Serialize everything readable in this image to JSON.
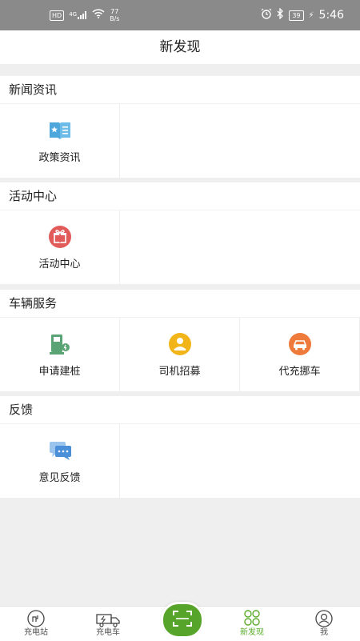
{
  "status_bar": {
    "hd": "HD",
    "net_gen": "4G",
    "speed_value": "77",
    "speed_unit": "B/s",
    "battery": "39",
    "time": "5:46"
  },
  "page": {
    "title": "新发现"
  },
  "sections": [
    {
      "title": "新闻资讯",
      "items": [
        {
          "label": "政策资讯",
          "icon": "policy-news-icon"
        }
      ]
    },
    {
      "title": "活动中心",
      "items": [
        {
          "label": "活动中心",
          "icon": "gift-icon"
        }
      ]
    },
    {
      "title": "车辆服务",
      "items": [
        {
          "label": "申请建桩",
          "icon": "charging-pile-icon"
        },
        {
          "label": "司机招募",
          "icon": "driver-recruit-icon"
        },
        {
          "label": "代充挪车",
          "icon": "car-move-icon"
        }
      ]
    },
    {
      "title": "反馈",
      "items": [
        {
          "label": "意见反馈",
          "icon": "feedback-chat-icon"
        }
      ]
    }
  ],
  "tab_bar": {
    "tabs": [
      {
        "label": "充电站",
        "icon": "charging-station-icon",
        "active": false
      },
      {
        "label": "充电车",
        "icon": "charging-truck-icon",
        "active": false
      },
      {
        "label": "新发现",
        "icon": "clover-icon",
        "active": true
      },
      {
        "label": "我",
        "icon": "user-icon",
        "active": false
      }
    ],
    "center_button_icon": "scan-icon"
  },
  "colors": {
    "accent_green": "#5aac2c",
    "status_bar_bg": "#8a8a8a",
    "policy_blue": "#4da7dc",
    "gift_red": "#e25b5b",
    "pile_green": "#5aa374",
    "driver_yellow": "#f2b519",
    "car_orange": "#ee7a3c",
    "feedback_blue": "#4a8fd8"
  }
}
